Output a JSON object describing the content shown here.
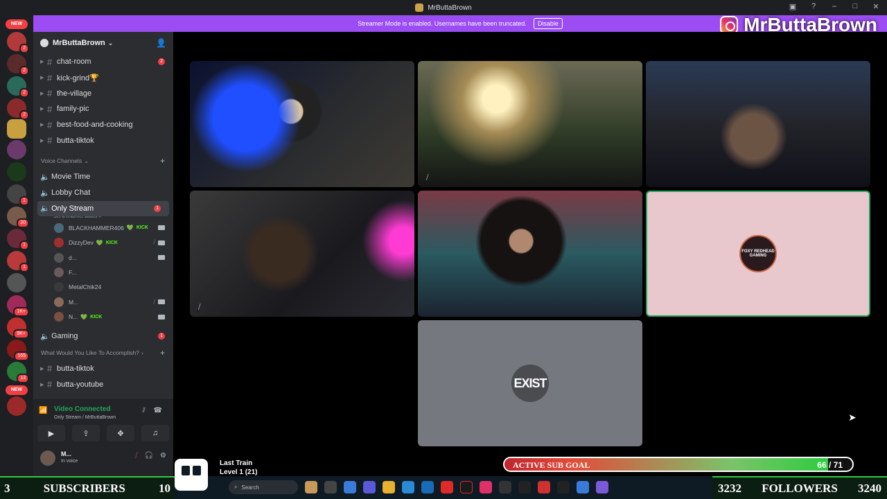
{
  "window": {
    "title": "MrButtaBrown"
  },
  "banner": {
    "text": "Streamer Mode is enabled. Usernames have been truncated.",
    "disable_label": "Disable"
  },
  "overlay": {
    "streamer_name": "MrButtaBrown"
  },
  "guild_rail": {
    "new_label": "NEW",
    "badges": [
      "2",
      "2",
      "2",
      "2",
      "1",
      "1",
      "20",
      "1",
      "1",
      "1",
      "1K+",
      "9K+",
      "165",
      "13"
    ]
  },
  "server": {
    "name": "MrButtaBrown",
    "text_channels": [
      {
        "name": "chat-room",
        "count": "2"
      },
      {
        "name": "kick-grind🏆"
      },
      {
        "name": "the-village"
      },
      {
        "name": "family-pic"
      },
      {
        "name": "best-food-and-cooking"
      },
      {
        "name": "butta-tiktok"
      }
    ],
    "voice_category": "Voice Channels",
    "voice_channels": [
      {
        "name": "Movie Time"
      },
      {
        "name": "Lobby Chat"
      }
    ],
    "active_voice": {
      "name": "Only Stream",
      "count": "1",
      "status_hint": "Set a channel status ✐"
    },
    "voice_users": [
      {
        "name": "BLACKHAMMER406",
        "kick": "KICK",
        "heart": "💚"
      },
      {
        "name": "DizzyDev",
        "kick": "KICK",
        "heart": "💚"
      },
      {
        "name": "d..."
      },
      {
        "name": "F..."
      },
      {
        "name": "MetalChik24"
      },
      {
        "name": "M..."
      },
      {
        "name": "N...",
        "kick": "KICK",
        "heart": "💚"
      }
    ],
    "gaming": {
      "name": "Gaming",
      "count": "1"
    },
    "category2": "What Would You Like To Accomplish?",
    "bottom_channels": [
      {
        "name": "butta-tiktok"
      },
      {
        "name": "butta-youtube"
      }
    ]
  },
  "voice_panel": {
    "title": "Video Connected",
    "subtitle": "Only Stream / MrButtaBrown"
  },
  "user_panel": {
    "name": "M...",
    "status": "In voice"
  },
  "tiles": {
    "foxy_logo_text": "FOXY REDHEAD GAMING",
    "exist_logo_text": "EXIST"
  },
  "music": {
    "title": "Last Train",
    "level": "Level 1 (21)"
  },
  "sub_goal": {
    "label": "ACTIVE SUB GOAL",
    "count": "66 / 71",
    "progress": 0.93
  },
  "subscribers": {
    "left": "3",
    "label": "SUBSCRIBERS",
    "right": "10"
  },
  "followers": {
    "left": "3232",
    "label": "FOLLOWERS",
    "right": "3240"
  },
  "taskbar": {
    "search_placeholder": "Search"
  }
}
